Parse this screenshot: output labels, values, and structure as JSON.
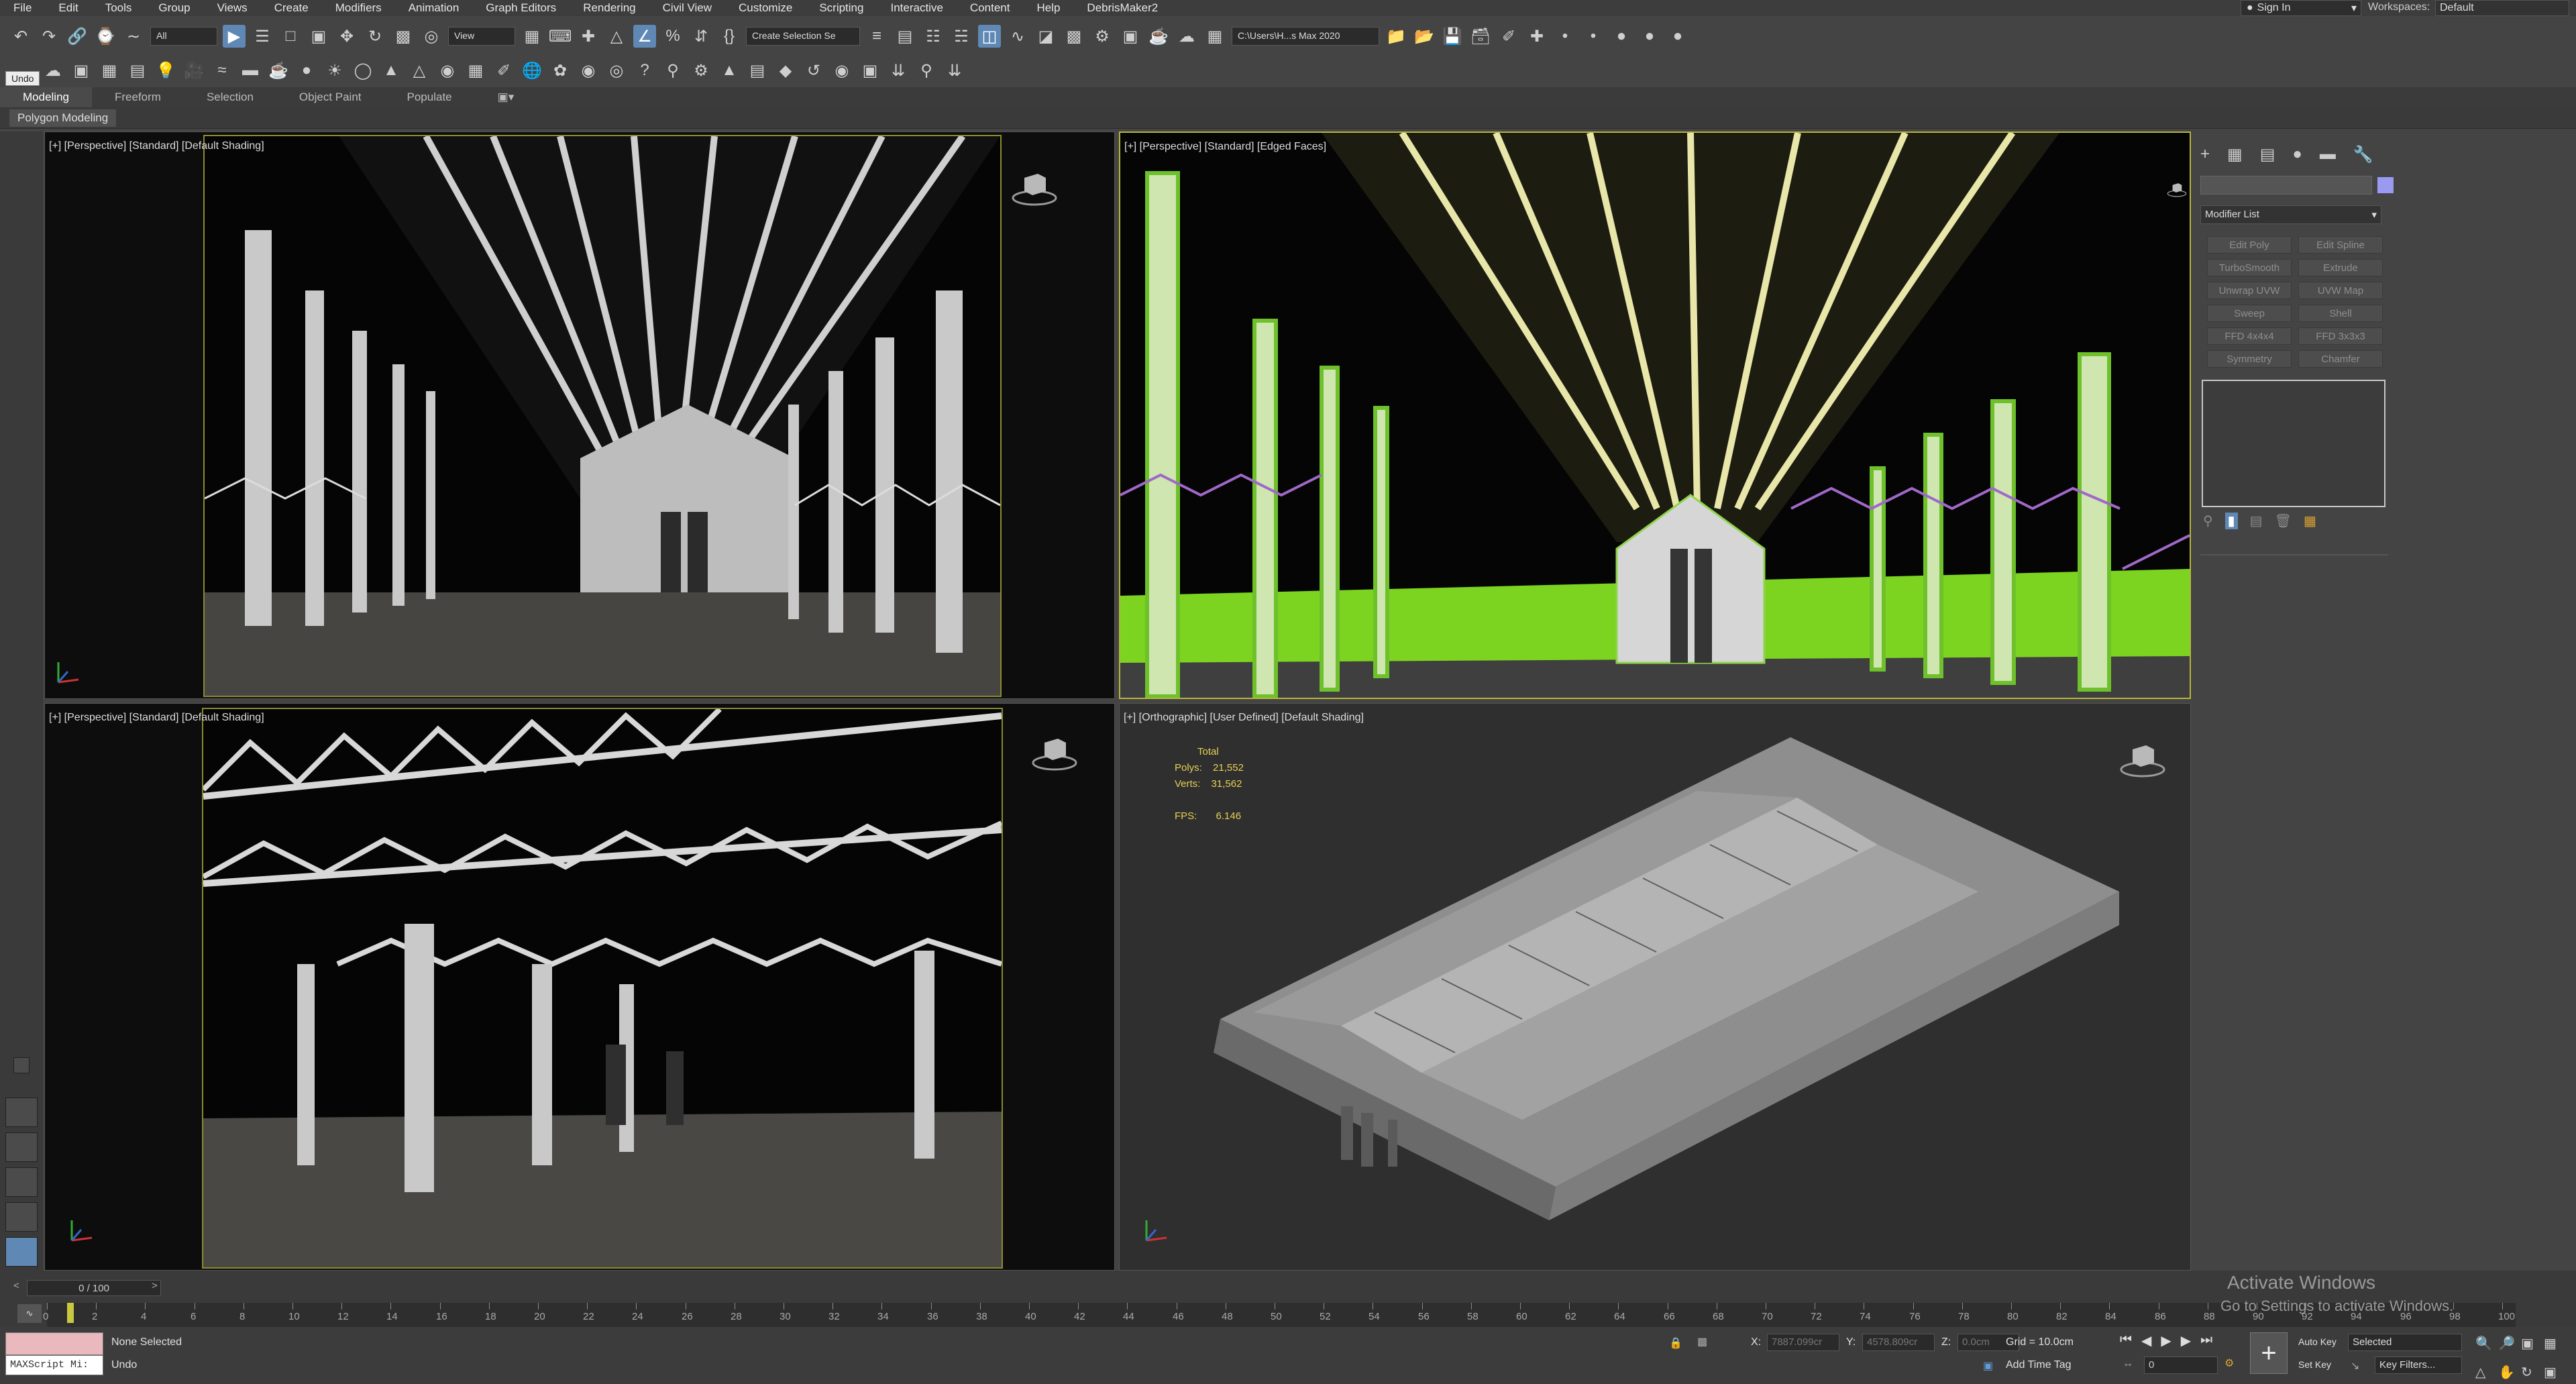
{
  "menu": [
    "File",
    "Edit",
    "Tools",
    "Group",
    "Views",
    "Create",
    "Modifiers",
    "Animation",
    "Graph Editors",
    "Rendering",
    "Civil View",
    "Customize",
    "Scripting",
    "Interactive",
    "Content",
    "Help",
    "DebrisMaker2"
  ],
  "signin": "Sign In",
  "workspaces_label": "Workspaces:",
  "workspaces_value": "Default",
  "toolbar": {
    "filter_value": "All",
    "refcoord_value": "View",
    "selection_set_value": "Create Selection Se",
    "project_path": "C:\\Users\\H...s Max 2020",
    "undo_tooltip": "Undo"
  },
  "ribbon_tabs": [
    "Modeling",
    "Freeform",
    "Selection",
    "Object Paint",
    "Populate"
  ],
  "ribbon_subtab": "Polygon Modeling",
  "viewports": {
    "top_left_label": "[+] [Perspective] [Standard] [Default Shading]",
    "top_right_label": "[+] [Perspective] [Standard] [Edged Faces]",
    "bottom_left_label": "[+] [Perspective] [Standard] [Default Shading]",
    "bottom_right_label": "[+] [Orthographic] [User Defined] [Default Shading]"
  },
  "stats": {
    "total": "Total",
    "polys_label": "Polys:",
    "polys": "21,552",
    "verts_label": "Verts:",
    "verts": "31,562",
    "fps_label": "FPS:",
    "fps": "6.146"
  },
  "command_panel": {
    "modifier_list": "Modifier List",
    "buttons": [
      "Edit Poly",
      "Edit Spline",
      "TurboSmooth",
      "Extrude",
      "Unwrap UVW",
      "UVW Map",
      "Sweep",
      "Shell",
      "FFD 4x4x4",
      "FFD 3x3x3",
      "Symmetry",
      "Chamfer"
    ]
  },
  "timeline": {
    "frame": "0 / 100",
    "ticks": [
      "0",
      "2",
      "4",
      "6",
      "8",
      "10",
      "12",
      "14",
      "16",
      "18",
      "20",
      "22",
      "24",
      "26",
      "28",
      "30",
      "32",
      "34",
      "36",
      "38",
      "40",
      "42",
      "44",
      "46",
      "48",
      "50",
      "52",
      "54",
      "56",
      "58",
      "60",
      "62",
      "64",
      "66",
      "68",
      "70",
      "72",
      "74",
      "76",
      "78",
      "80",
      "82",
      "84",
      "86",
      "88",
      "90",
      "92",
      "94",
      "96",
      "98",
      "100"
    ]
  },
  "status": {
    "maxscript": "MAXScript Mi:",
    "selection": "None Selected",
    "prompt": "Undo",
    "x_label": "X:",
    "x_value": "7887.099cr",
    "y_label": "Y:",
    "y_value": "4578.809cr",
    "z_label": "Z:",
    "z_value": "0.0cm",
    "grid": "Grid = 10.0cm",
    "add_time_tag": "Add Time Tag",
    "auto_key": "Auto Key",
    "set_key": "Set Key",
    "key_mode": "Selected",
    "key_filters": "Key Filters...",
    "frame_field": "0"
  },
  "watermark": {
    "line1": "Activate Windows",
    "line2": "Go to Settings to activate Windows."
  }
}
